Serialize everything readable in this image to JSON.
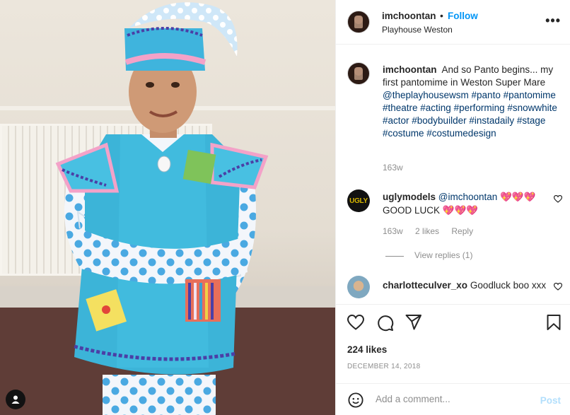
{
  "post": {
    "username": "imchoontan",
    "separator": "•",
    "follow_label": "Follow",
    "location": "Playhouse Weston",
    "more_label": "•••"
  },
  "caption": {
    "username": "imchoontan",
    "text": "And so Panto begins... my first pantomime in Weston Super Mare",
    "mention": "@theplayhousewsm",
    "hashtags": "#panto #pantomime #theatre #acting #performing #snowwhite #actor #bodybuilder #instadaily #stage #costume #costumedesign",
    "time": "163w"
  },
  "comments": [
    {
      "avatar_text": "UGLY",
      "username": "uglymodels",
      "mention": "@imchoontan",
      "text_line1_emoji": "💖💖💖",
      "text_line2": "GOOD LUCK",
      "text_line2_emoji": "💖💖💖",
      "time": "163w",
      "likes": "2 likes",
      "reply_label": "Reply",
      "view_replies": "View replies (1)"
    },
    {
      "username": "charlotteculver_xo",
      "text": "Goodluck boo xxx"
    }
  ],
  "engagement": {
    "likes": "224 likes",
    "date": "DECEMBER 14, 2018"
  },
  "add_comment": {
    "placeholder": "Add a comment...",
    "post_label": "Post"
  },
  "icons": {
    "like": "heart-icon",
    "comment": "comment-icon",
    "share": "share-icon",
    "save": "bookmark-icon",
    "emoji": "emoji-icon",
    "comment_like": "heart-small-icon",
    "threads": "threads-icon"
  },
  "colors": {
    "link": "#0095f6",
    "hashtag": "#00376b",
    "muted": "#8e8e8e",
    "post_disabled": "#b2dffc"
  }
}
